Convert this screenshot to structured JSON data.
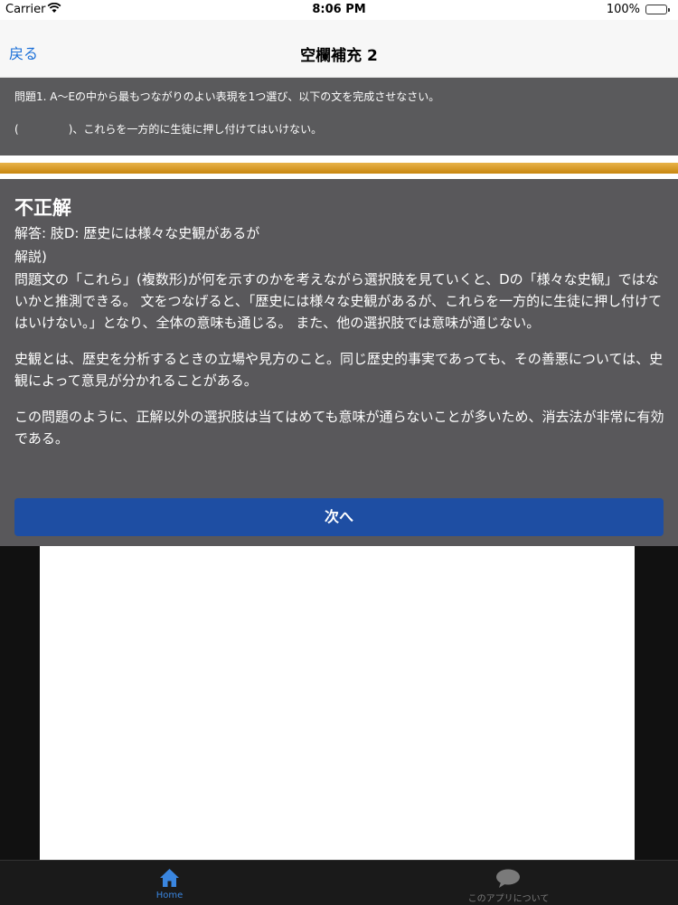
{
  "status_bar": {
    "carrier": "Carrier",
    "time": "8:06 PM",
    "battery": "100%"
  },
  "nav": {
    "back_label": "戻る",
    "title": "空欄補充 2"
  },
  "question": {
    "prompt": "問題1. A〜Eの中から最もつながりのよい表現を1つ選び、以下の文を完成させなさい。",
    "open_paren": "(",
    "sentence_after_blank": ")、これらを一方的に生徒に押し付けてはいけない。"
  },
  "progress": {
    "fraction": 1.0
  },
  "result": {
    "title": "不正解",
    "answer": "解答: 肢D: 歴史には様々な史観があるが",
    "explanation_label": "解説)",
    "paragraphs": [
      "問題文の「これら」(複数形)が何を示すのかを考えながら選択肢を見ていくと、Dの「様々な史観」ではないかと推測できる。 文をつなげると、「歴史には様々な史観があるが、これらを一方的に生徒に押し付けてはいけない。」となり、全体の意味も通じる。 また、他の選択肢では意味が通じない。",
      "史観とは、歴史を分析するときの立場や見方のこと。同じ歴史的事実であっても、その善悪については、史観によって意見が分かれることがある。",
      "この問題のように、正解以外の選択肢は当てはめても意味が通らないことが多いため、消去法が非常に有効である。"
    ],
    "next_label": "次へ"
  },
  "tabs": [
    {
      "label": "Home",
      "icon": "home-icon",
      "active": true
    },
    {
      "label": "このアプリについて",
      "icon": "speech-bubble-icon",
      "active": false
    }
  ],
  "colors": {
    "accent": "#1a6fd8",
    "next_button": "#1e4ea3",
    "overlay": "#59585b",
    "progress": "#d8981f"
  }
}
